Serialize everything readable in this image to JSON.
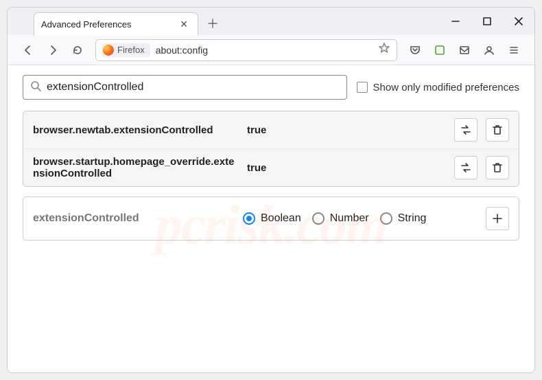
{
  "tab": {
    "title": "Advanced Preferences"
  },
  "toolbar": {
    "firefox_badge": "Firefox",
    "url": "about:config"
  },
  "search": {
    "value": "extensionControlled",
    "show_modified_label": "Show only modified preferences"
  },
  "prefs": [
    {
      "name": "browser.newtab.extensionControlled",
      "value": "true"
    },
    {
      "name": "browser.startup.homepage_override.extensionControlled",
      "value": "true"
    }
  ],
  "newpref": {
    "label": "extensionControlled",
    "types": {
      "boolean": "Boolean",
      "number": "Number",
      "string": "String"
    }
  },
  "watermark": "pcrisk.com"
}
